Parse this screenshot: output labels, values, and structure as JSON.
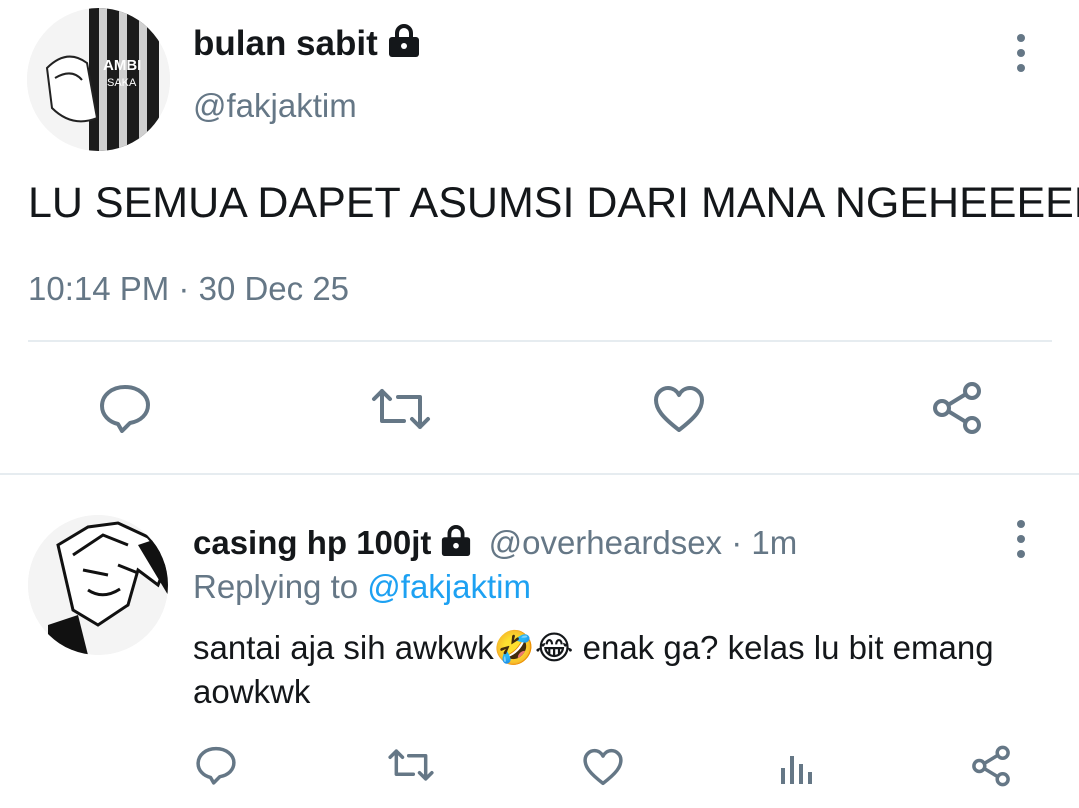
{
  "main_tweet": {
    "display_name": "bulan sabit",
    "handle": "@fakjaktim",
    "text": "LU SEMUA DAPET ASUMSI DARI MANA NGEHEEEEE",
    "time": "10:14 PM",
    "separator": "·",
    "date": "30 Dec 25",
    "avatar_text_top": "AMBI",
    "avatar_text_bottom": "SAKA",
    "actions": [
      "reply-icon",
      "retweet-icon",
      "like-icon",
      "share-icon"
    ]
  },
  "reply_tweet": {
    "display_name": "casing hp 100jt",
    "handle": "@overheardsex",
    "separator": "·",
    "age": "1m",
    "replying_prefix": "Replying to",
    "replying_handle": "@fakjaktim",
    "text_line1": "santai aja sih awkwk🤣😂 enak ga? kelas lu bit emang",
    "text_line2": "aowkwk",
    "actions": [
      "reply-icon",
      "retweet-icon",
      "like-icon",
      "analytics-icon",
      "share-icon"
    ]
  },
  "colors": {
    "text": "#14171a",
    "muted": "#657786",
    "link": "#1da1f2",
    "divider": "#e6ecf0"
  }
}
